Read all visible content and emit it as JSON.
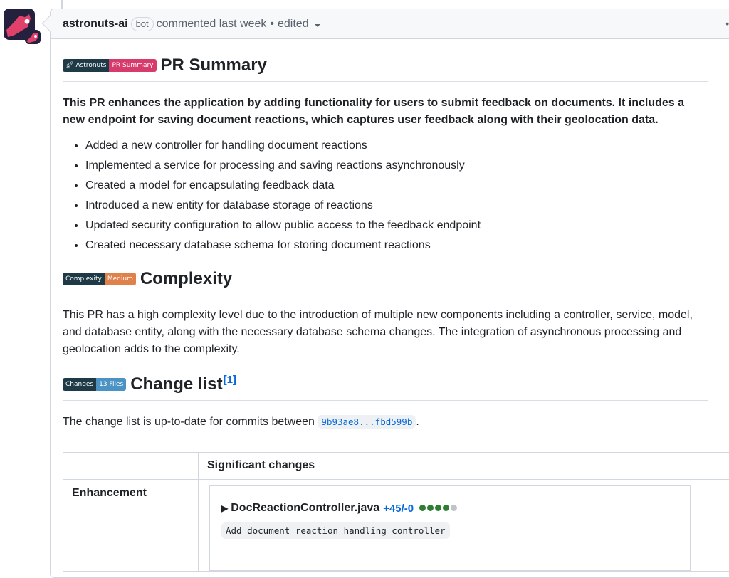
{
  "comment": {
    "author": "astronuts-ai",
    "author_label": "bot",
    "meta": "commented last week",
    "separator": "•",
    "edited": "edited",
    "more_options_icon": "kebab-horizontal-icon",
    "more_options_glyph": "•••"
  },
  "pr_summary": {
    "badge_left": "Astronuts",
    "badge_left_icon": "rocket-icon",
    "badge_right": "PR Summary",
    "badge_right_color": "#d63b6b",
    "title": "PR Summary",
    "lead": "This PR enhances the application by adding functionality for users to submit feedback on documents. It includes a new endpoint for saving document reactions, which captures user feedback along with their geolocation data.",
    "bullets": [
      "Added a new controller for handling document reactions",
      "Implemented a service for processing and saving reactions asynchronously",
      "Created a model for encapsulating feedback data",
      "Introduced a new entity for database storage of reactions",
      "Updated security configuration to allow public access to the feedback endpoint",
      "Created necessary database schema for storing document reactions"
    ]
  },
  "complexity": {
    "badge_left": "Complexity",
    "badge_right": "Medium",
    "badge_right_color": "#e0804a",
    "title": "Complexity",
    "text": "This PR has a high complexity level due to the introduction of multiple new components including a controller, service, model, and database entity, along with the necessary database schema changes. The integration of asynchronous processing and geolocation adds to the complexity."
  },
  "change_list": {
    "badge_left": "Changes",
    "badge_right": "13 Files",
    "badge_right_color": "#4a93c4",
    "title": "Change list",
    "footnote": "[1]",
    "intro": "The change list is up-to-date for commits between",
    "commit_range": "9b93ae8...fbd599b",
    "intro_end": ".",
    "table": {
      "headers": [
        "",
        "Significant changes"
      ],
      "rows": [
        {
          "category": "Enhancement",
          "file": {
            "toggle_glyph": "▶",
            "name": "DocReactionController.java",
            "diff": "+45/-0",
            "impact_filled": 4,
            "impact_total": 5,
            "impact_color": "#2f7d32",
            "impact_empty_color": "#c0c4c8",
            "description": "Add document reaction handling controller"
          }
        }
      ]
    }
  }
}
